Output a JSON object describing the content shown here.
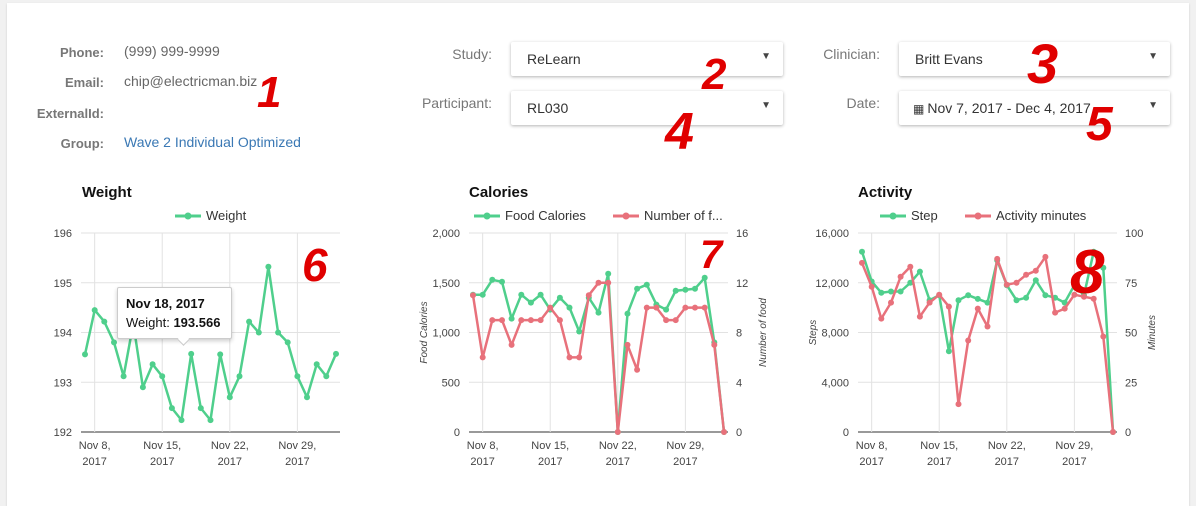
{
  "info": {
    "phone_label": "Phone:",
    "phone": "(999) 999-9999",
    "email_label": "Email:",
    "email": "chip@electricman.biz",
    "external_label": "ExternalId:",
    "group_label": "Group:",
    "group": "Wave 2 Individual Optimized"
  },
  "filters": {
    "study_label": "Study:",
    "study": "ReLearn",
    "participant_label": "Participant:",
    "participant": "RL030",
    "clinician_label": "Clinician:",
    "clinician": "Britt Evans",
    "date_label": "Date:",
    "date": "Nov 7, 2017 - Dec 4, 2017",
    "calendar_icon": "calendar-icon",
    "caret_icon": "caret-down-icon"
  },
  "annotations": [
    "1",
    "2",
    "3",
    "4",
    "5",
    "6",
    "7",
    "8"
  ],
  "tooltip": {
    "date": "Nov 18, 2017",
    "label": "Weight: ",
    "value": "193.566"
  },
  "chart_data": [
    {
      "type": "line",
      "title": "Weight",
      "x_ticks": [
        [
          "Nov 8,",
          "2017"
        ],
        [
          "Nov 15,",
          "2017"
        ],
        [
          "Nov 22,",
          "2017"
        ],
        [
          "Nov 29,",
          "2017"
        ]
      ],
      "y_ticks": [
        "196",
        "195",
        "194",
        "193",
        "192"
      ],
      "ylim": [
        192,
        196
      ],
      "legend_position": "top",
      "series": [
        {
          "name": "Weight",
          "color": "#4fcf8c",
          "values": [
            193.56,
            194.45,
            194.22,
            193.8,
            193.12,
            194.18,
            192.9,
            193.36,
            193.12,
            192.48,
            192.24,
            193.57,
            192.48,
            192.24,
            193.56,
            192.7,
            193.12,
            194.22,
            194.0,
            195.32,
            194.0,
            193.8,
            193.12,
            192.7,
            193.36,
            193.12,
            193.57
          ]
        }
      ]
    },
    {
      "type": "line",
      "title": "Calories",
      "x_ticks": [
        [
          "Nov 8,",
          "2017"
        ],
        [
          "Nov 15,",
          "2017"
        ],
        [
          "Nov 22,",
          "2017"
        ],
        [
          "Nov 29,",
          "2017"
        ]
      ],
      "y_ticks": [
        "2,000",
        "1,500",
        "1,000",
        "500",
        "0"
      ],
      "y2_ticks": [
        "16",
        "12",
        "8",
        "4",
        "0"
      ],
      "ylabel": "Food Calories",
      "y2label": "Number of food",
      "ylim": [
        0,
        2000
      ],
      "y2lim": [
        0,
        16
      ],
      "legend_position": "top",
      "series": [
        {
          "name": "Food Calories",
          "color": "#4fcf8c",
          "axis": "left",
          "values": [
            1380,
            1380,
            1530,
            1510,
            1140,
            1380,
            1300,
            1380,
            1230,
            1350,
            1250,
            1010,
            1350,
            1200,
            1590,
            0,
            1190,
            1440,
            1480,
            1280,
            1230,
            1420,
            1430,
            1440,
            1550,
            900,
            0
          ]
        },
        {
          "name": "Number of f...",
          "color": "#e8717b",
          "axis": "right",
          "values": [
            11,
            6,
            9,
            9,
            7,
            9,
            9,
            9,
            10,
            9,
            6,
            6,
            11,
            12,
            12,
            0,
            7,
            5,
            10,
            10,
            9,
            9,
            10,
            10,
            10,
            7,
            0
          ]
        }
      ]
    },
    {
      "type": "line",
      "title": "Activity",
      "x_ticks": [
        [
          "Nov 8,",
          "2017"
        ],
        [
          "Nov 15,",
          "2017"
        ],
        [
          "Nov 22,",
          "2017"
        ],
        [
          "Nov 29,",
          "2017"
        ]
      ],
      "y_ticks": [
        "16,000",
        "12,000",
        "8,000",
        "4,000",
        "0"
      ],
      "y2_ticks": [
        "100",
        "75",
        "50",
        "25",
        "0"
      ],
      "ylabel": "Steps",
      "y2label": "Minutes",
      "ylim": [
        0,
        16000
      ],
      "y2lim": [
        0,
        100
      ],
      "legend_position": "top",
      "series": [
        {
          "name": "Step",
          "color": "#4fcf8c",
          "axis": "left",
          "values": [
            14500,
            12100,
            11200,
            11300,
            11300,
            12000,
            12900,
            10600,
            11000,
            6500,
            10600,
            11000,
            10700,
            10400,
            13800,
            11800,
            10600,
            10800,
            12200,
            11000,
            10800,
            10400,
            11800,
            11000,
            14500,
            13200,
            0
          ]
        },
        {
          "name": "Activity minutes",
          "color": "#e8717b",
          "axis": "right",
          "values": [
            85,
            73,
            57,
            65,
            78,
            83,
            58,
            65,
            69,
            63,
            14,
            46,
            62,
            53,
            87,
            74,
            75,
            79,
            81,
            88,
            60,
            62,
            69,
            68,
            67,
            48,
            0
          ]
        }
      ]
    }
  ]
}
